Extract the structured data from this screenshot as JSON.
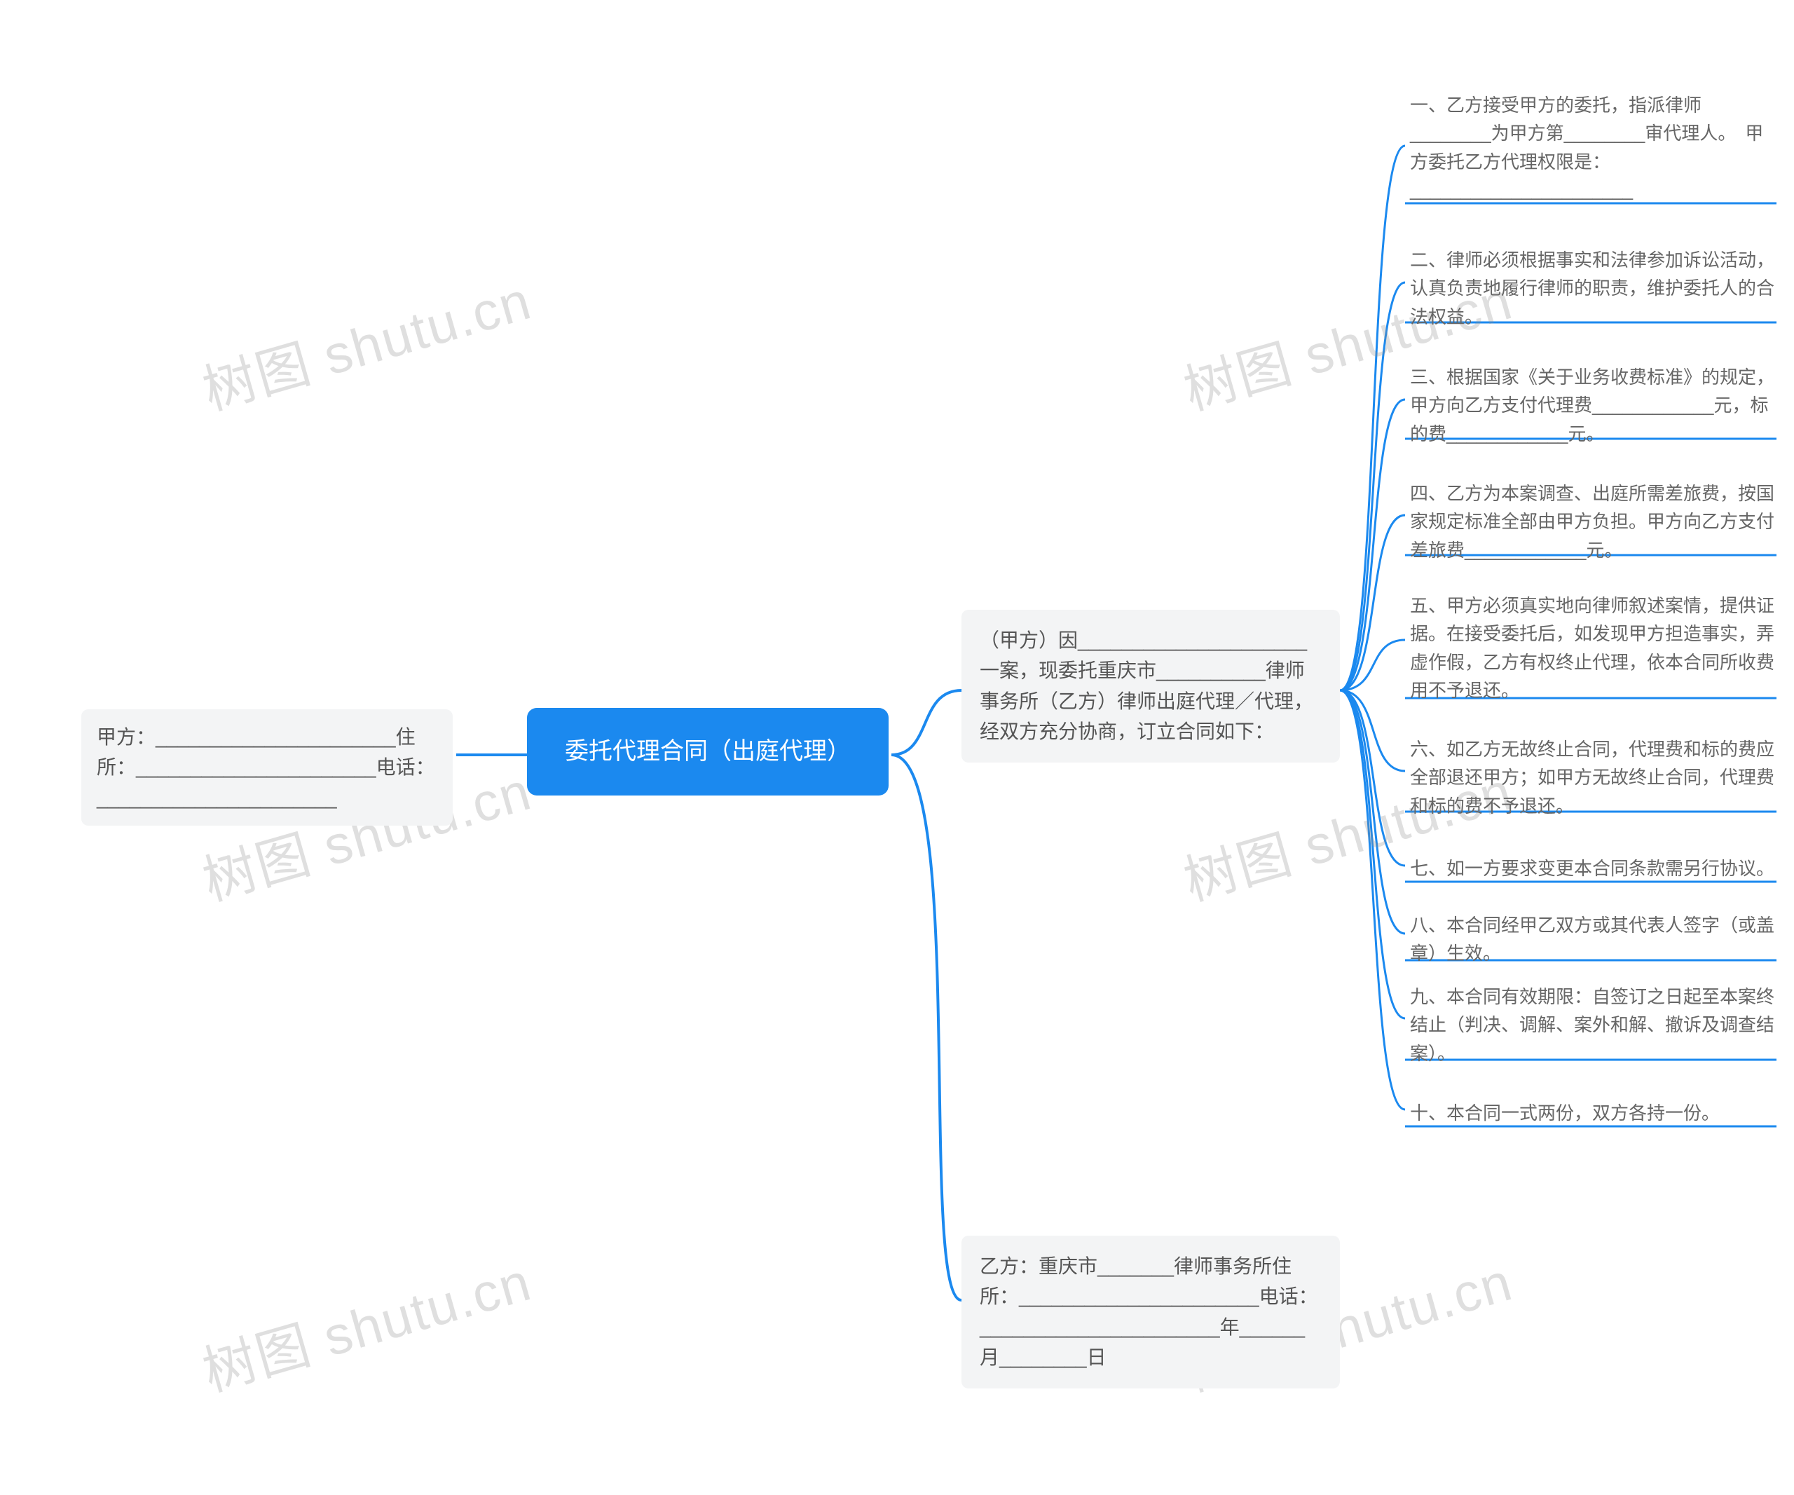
{
  "root": {
    "label": "委托代理合同（出庭代理）"
  },
  "left": {
    "party_a": "甲方：______________________住所：______________________电话：______________________"
  },
  "branches": [
    {
      "label": "（甲方）因_____________________一案，现委托重庆市__________律师事务所（乙方）律师出庭代理／代理，经双方充分协商，订立合同如下：",
      "leaves": [
        "一、乙方接受甲方的委托，指派律师________为甲方第________审代理人。　甲方委托乙方代理权限是：______________________",
        "二、律师必须根据事实和法律参加诉讼活动，认真负责地履行律师的职责，维护委托人的合法权益。",
        "三、根据国家《关于业务收费标准》的规定，甲方向乙方支付代理费____________元，标的费____________元。",
        "四、乙方为本案调查、出庭所需差旅费，按国家规定标准全部由甲方负担。甲方向乙方支付差旅费____________元。",
        "五、甲方必须真实地向律师叙述案情，提供证据。在接受委托后，如发现甲方担造事实，弄虚作假，乙方有权终止代理，依本合同所收费用不予退还。",
        "六、如乙方无故终止合同，代理费和标的费应全部退还甲方；如甲方无故终止合同，代理费和标的费不予退还。",
        "七、如一方要求变更本合同条款需另行协议。",
        "八、本合同经甲乙双方或其代表人签字（或盖章）生效。",
        "九、本合同有效期限：自签订之日起至本案终结止（判决、调解、案外和解、撤诉及调查结案）。",
        "十、本合同一式两份，双方各持一份。"
      ]
    },
    {
      "label": "乙方：重庆市_______律师事务所住所：______________________电话：______________________年______月________日"
    }
  ],
  "watermarks": [
    "树图 shutu.cn",
    "树图 shutu.cn",
    "树图 shutu.cn",
    "树图 shutu.cn",
    "树图 shutu.cn",
    "树图 shutu.cn"
  ]
}
